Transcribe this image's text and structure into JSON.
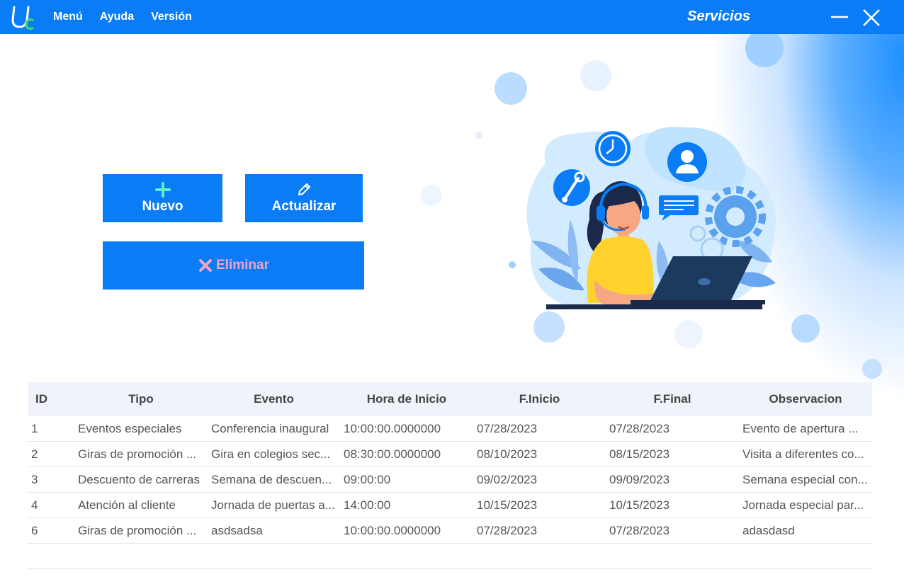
{
  "window": {
    "title": "Servicios",
    "menu": [
      "Menú",
      "Ayuda",
      "Versión"
    ]
  },
  "actions": {
    "new_label": "Nuevo",
    "update_label": "Actualizar",
    "delete_label": "Eliminar"
  },
  "icons": {
    "new": "plus-icon",
    "update": "pencil-icon",
    "delete": "x-icon",
    "minimize": "minimize-icon",
    "close": "close-icon"
  },
  "colors": {
    "titlebar": "#0a7cf5",
    "button": "#0a7cf5",
    "plus_icon": "#5ef0c8",
    "delete_accent": "#f4a3c4",
    "header_bg": "#eff4fb"
  },
  "table": {
    "columns": [
      "ID",
      "Tipo",
      "Evento",
      "Hora de Inicio",
      "F.Inicio",
      "F.Final",
      "Observacion"
    ],
    "rows": [
      [
        "1",
        "Eventos especiales",
        "Conferencia inaugural",
        "10:00:00.0000000",
        "07/28/2023",
        "07/28/2023",
        "Evento de apertura ..."
      ],
      [
        "2",
        "Giras de promoción ...",
        "Gira en colegios sec...",
        "08:30:00.0000000",
        "08/10/2023",
        "08/15/2023",
        "Visita a diferentes co..."
      ],
      [
        "3",
        "Descuento de carreras",
        "Semana de descuen...",
        "09:00:00",
        "09/02/2023",
        "09/09/2023",
        "Semana especial con..."
      ],
      [
        "4",
        "Atención al cliente",
        "Jornada de puertas a...",
        "14:00:00",
        "10/15/2023",
        "10/15/2023",
        "Jornada especial par..."
      ],
      [
        "6",
        "Giras de promoción ...",
        "asdsadsa",
        "10:00:00.0000000",
        "07/28/2023",
        "07/28/2023",
        "adasdasd"
      ]
    ]
  }
}
